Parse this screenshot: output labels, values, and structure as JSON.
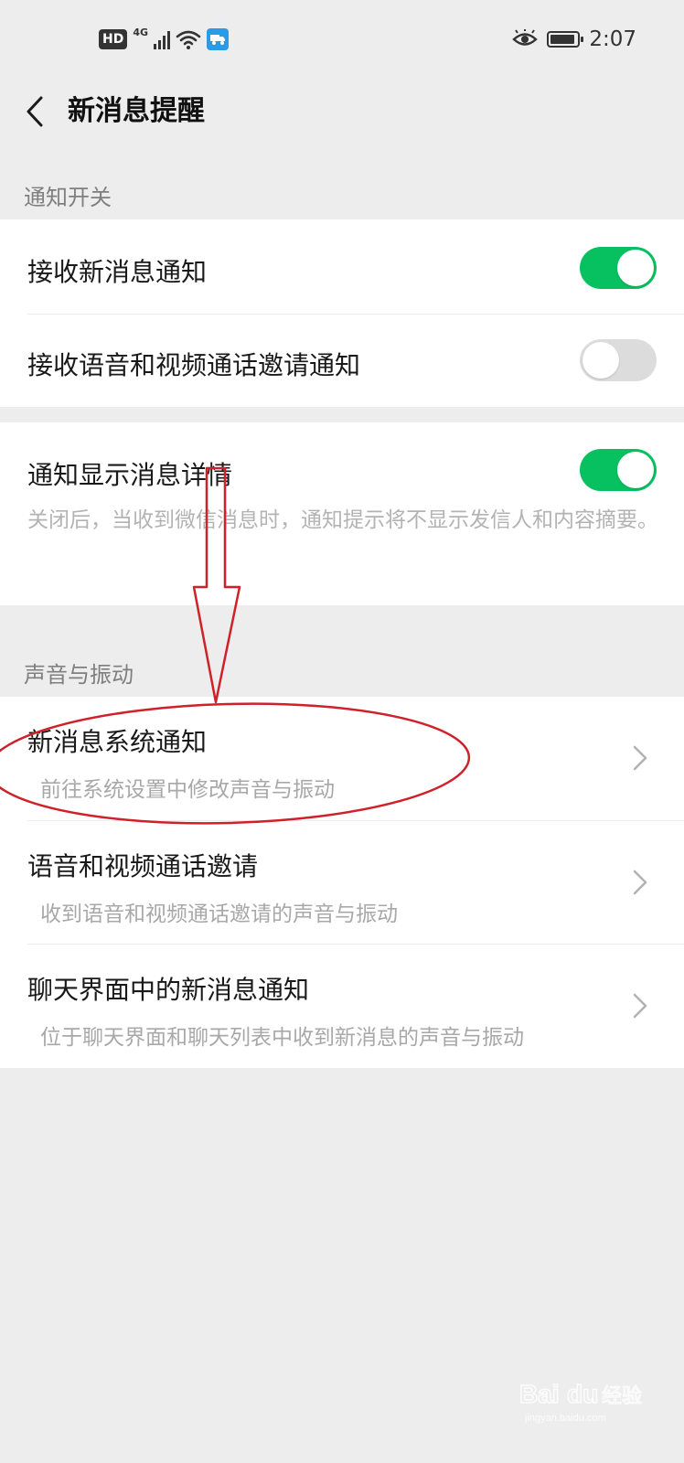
{
  "status_bar": {
    "hd_label": "HD",
    "network_label": "4G",
    "time": "2:07",
    "icons": [
      "hd-icon",
      "signal-icon",
      "wifi-icon",
      "truck-app-icon",
      "eye-icon",
      "battery-icon"
    ]
  },
  "header": {
    "back_icon": "chevron-left-icon",
    "title": "新消息提醒"
  },
  "sections": {
    "notify_switch": {
      "label": "通知开关",
      "items": [
        {
          "title": "接收新消息通知",
          "toggle": true
        },
        {
          "title": "接收语音和视频通话邀请通知",
          "toggle": false
        }
      ]
    },
    "detail": {
      "title": "通知显示消息详情",
      "toggle": true,
      "description": "关闭后，当收到微信消息时，通知提示将不显示发信人和内容摘要。"
    },
    "sound_vibration": {
      "label": "声音与振动",
      "items": [
        {
          "title": "新消息系统通知",
          "subtitle": "前往系统设置中修改声音与振动"
        },
        {
          "title": "语音和视频通话邀请",
          "subtitle": "收到语音和视频通话邀请的声音与振动"
        },
        {
          "title": "聊天界面中的新消息通知",
          "subtitle": "位于聊天界面和聊天列表中收到新消息的声音与振动"
        }
      ]
    }
  },
  "colors": {
    "accent_green": "#07c160",
    "annotation_red": "#d0202a",
    "background": "#ededed"
  },
  "watermark": {
    "text": "Baidu经验",
    "sub": "jingyan.baidu.com"
  }
}
